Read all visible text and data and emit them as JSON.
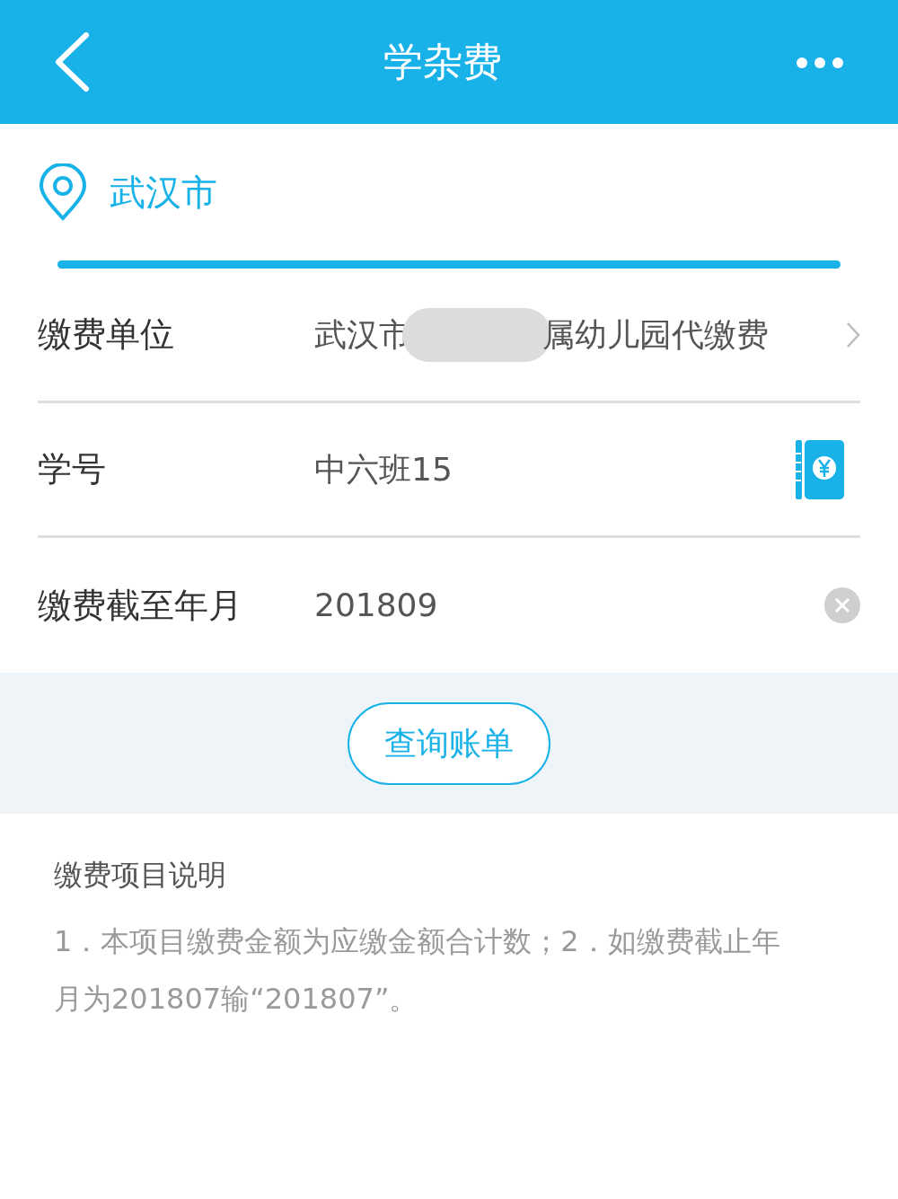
{
  "header": {
    "title": "学杂费"
  },
  "location": {
    "city": "武汉市"
  },
  "form_rows": [
    {
      "kind": "select",
      "label": "缴费单位",
      "value_before_blur": "武汉市",
      "value_after_blur": "属幼儿园代缴费"
    },
    {
      "kind": "contacts",
      "label": "学号",
      "value": "中六班15"
    },
    {
      "kind": "clearable",
      "label": "缴费截至年月",
      "value": "201809"
    }
  ],
  "query_button": "查询账单",
  "notes": {
    "title": "缴费项目说明",
    "body": "1．本项目缴费金额为应缴金额合计数；2．如缴费截止年月为201807输“201807”。"
  }
}
